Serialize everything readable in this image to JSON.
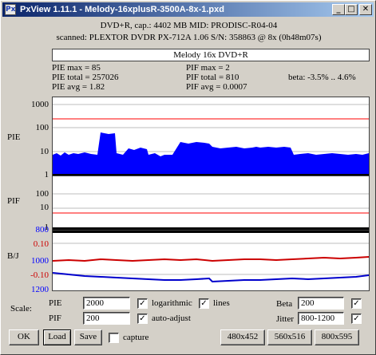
{
  "window": {
    "title": "PxView 1.11.1  -  Melody-16xplusR-3500A-8x-1.pxd",
    "icon_glyph": "Px",
    "controls": {
      "minimize": "_",
      "maximize": "□",
      "close": "✕"
    }
  },
  "header": {
    "line1": "DVD+R, cap.: 4402 MB MID: PRODISC-R04-04",
    "line2": "scanned: PLEXTOR DVDR PX-712A 1.06 S/N: 358863 @ 8x (0h48m07s)",
    "disc_label": "Melody 16x DVD+R"
  },
  "stats": {
    "pie_max": "PIE max = 85",
    "pie_total": "PIE total = 257026",
    "pie_avg": "PIE avg = 1.82",
    "pif_max": "PIF max = 2",
    "pif_total": "PIF total = 810",
    "pif_avg": "PIF avg = 0.0007",
    "beta": "beta: -3.5% .. 4.6%"
  },
  "plots": {
    "pie": {
      "label": "PIE",
      "ticks": [
        "1000",
        "100",
        "10",
        "1"
      ]
    },
    "pif": {
      "label": "PIF",
      "ticks": [
        "100",
        "10",
        "1"
      ]
    },
    "bj": {
      "label": "B/J",
      "ticks_jitter": [
        "800",
        "1000",
        "1200"
      ],
      "ticks_beta": [
        "0.10",
        "-0.10"
      ]
    }
  },
  "colors": {
    "pie_fill": "#0000ff",
    "threshold_line": "#ff0000",
    "beta_line": "#cc0000",
    "jitter_line": "#0000cc",
    "tick_blue": "#0000ff",
    "tick_red": "#cc0000"
  },
  "scale": {
    "label": "Scale:",
    "pie_label": "PIE",
    "pie_value": "2000",
    "pif_label": "PIF",
    "pif_value": "200",
    "logarithmic_label": "logarithmic",
    "logarithmic_checked": "✓",
    "lines_label": "lines",
    "lines_checked": "✓",
    "auto_adjust_label": "auto-adjust",
    "auto_adjust_checked": "✓",
    "beta_label": "Beta",
    "beta_value": "200",
    "beta_checked": "✓",
    "jitter_label": "Jitter",
    "jitter_value": "800-1200",
    "jitter_checked": "✓"
  },
  "buttons": {
    "ok": "OK",
    "load": "Load",
    "save": "Save",
    "capture_label": "capture",
    "size1": "480x452",
    "size2": "560x516",
    "size3": "800x595"
  }
}
